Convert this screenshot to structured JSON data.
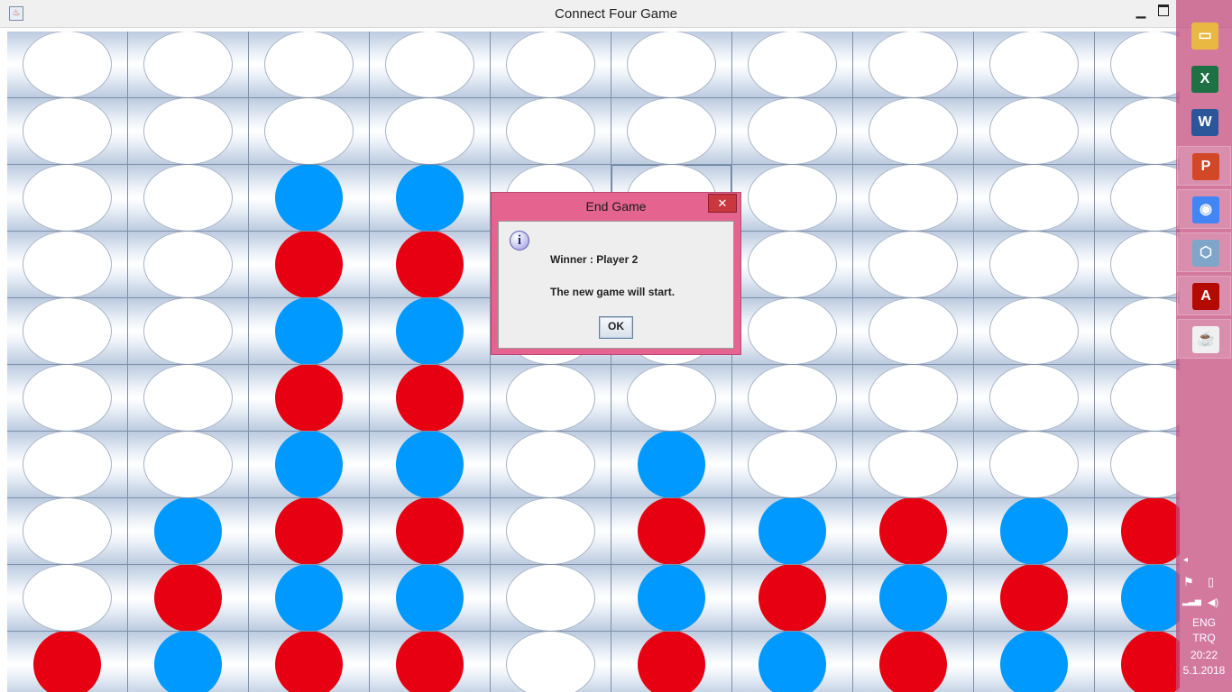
{
  "window": {
    "title": "Connect Four Game",
    "icon": "java-app-icon",
    "min_glyph": "▁"
  },
  "board": {
    "rows": 10,
    "cols": 10,
    "colors": {
      "blue": "#0099ff",
      "red": "#e60012",
      "empty": "#ffffff"
    },
    "cells": [
      "..........",
      "..........",
      "..BB......",
      "..RR......",
      "..BB......",
      "..RR......",
      "..BB.B....",
      ".BRR.RBRBR",
      ".RBB.BRBRB",
      "RBRR.RBRBR"
    ]
  },
  "dialog": {
    "title": "End Game",
    "close_glyph": "✕",
    "icon_glyph": "i",
    "message_line1": "Winner : Player 2",
    "message_line2": "The new game will start.",
    "ok_label": "OK"
  },
  "taskbar": {
    "apps": [
      {
        "name": "file-explorer-icon",
        "glyph": "▭",
        "bg": "#e8b842"
      },
      {
        "name": "excel-icon",
        "glyph": "X",
        "bg": "#1e7145"
      },
      {
        "name": "word-icon",
        "glyph": "W",
        "bg": "#2b579a"
      },
      {
        "name": "powerpoint-icon",
        "glyph": "P",
        "bg": "#d24726"
      },
      {
        "name": "chrome-icon",
        "glyph": "◉",
        "bg": "#4285f4"
      },
      {
        "name": "virtualbox-icon",
        "glyph": "⬡",
        "bg": "#7fa6c9"
      },
      {
        "name": "acrobat-reader-icon",
        "glyph": "A",
        "bg": "#b30b00"
      },
      {
        "name": "java-icon",
        "glyph": "☕",
        "bg": "#f0f0f0"
      }
    ],
    "tray": {
      "chevron": "◂",
      "flag_glyph": "⚑",
      "battery_glyph": "▯",
      "signal_glyph": "▂▃▅",
      "volume_glyph": "◀)",
      "language": "ENG",
      "layout": "TRQ",
      "time": "20:22",
      "date": "5.1.2018"
    }
  }
}
